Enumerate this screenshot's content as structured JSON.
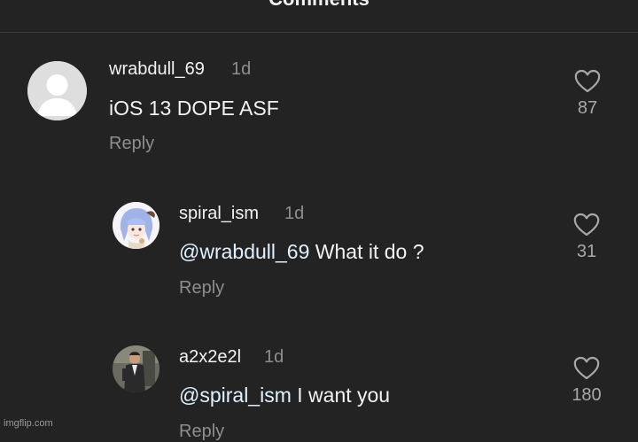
{
  "header": {
    "title": "Comments"
  },
  "comments": [
    {
      "username": "wrabdull_69",
      "time": "1d",
      "mention": "",
      "text": "iOS 13 DOPE ASF",
      "reply_label": "Reply",
      "likes": "87",
      "avatar": "default-avatar-icon"
    },
    {
      "username": "spiral_ism",
      "time": "1d",
      "mention": "@wrabdull_69",
      "text": " What it do ?",
      "reply_label": "Reply",
      "likes": "31",
      "avatar": "anime-character-avatar"
    },
    {
      "username": "a2x2e2l",
      "time": "1d",
      "mention": "@spiral_ism",
      "text": " I want you",
      "reply_label": "Reply",
      "likes": "180",
      "avatar": "person-photo-avatar"
    }
  ],
  "watermark": "imgflip.com",
  "colors": {
    "background": "#232323",
    "mention": "#e0f1ff",
    "muted": "#8e8e8e"
  }
}
